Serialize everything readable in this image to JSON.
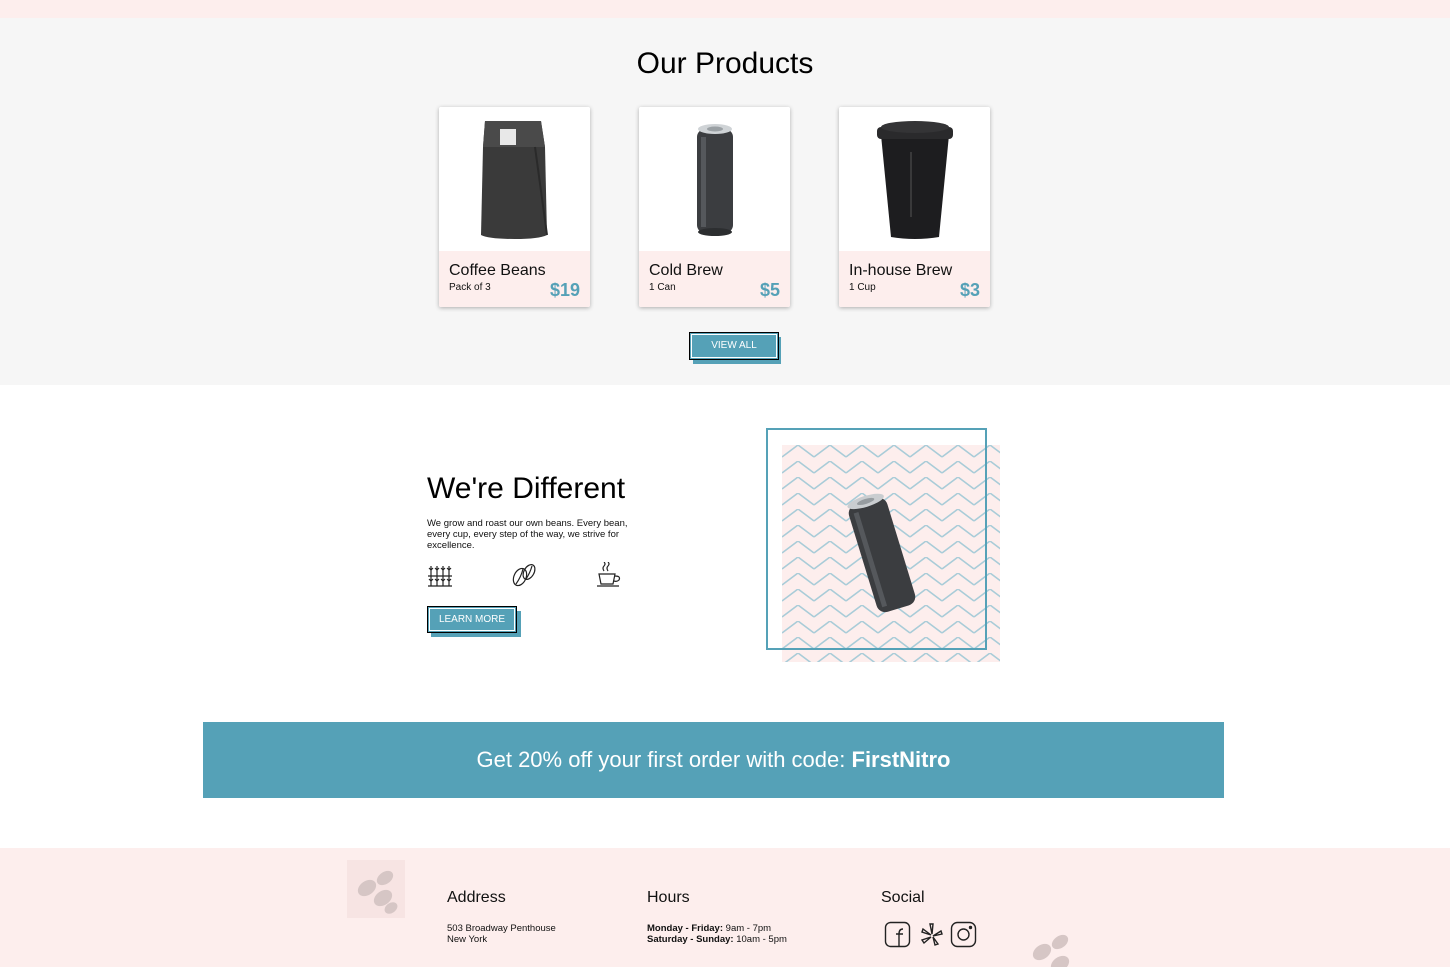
{
  "products_section": {
    "title": "Our Products",
    "items": [
      {
        "name": "Coffee Beans",
        "qty": "Pack of 3",
        "price": "$19"
      },
      {
        "name": "Cold Brew",
        "qty": "1 Can",
        "price": "$5"
      },
      {
        "name": "In-house Brew",
        "qty": "1 Cup",
        "price": "$3"
      }
    ],
    "view_all_label": "VIEW ALL"
  },
  "different_section": {
    "title": "We're Different",
    "text": "We grow and roast our own beans. Every bean, every cup, every step of the way, we strive for excellence.",
    "icons": [
      "plants-icon",
      "coffee-bean-icon",
      "coffee-cup-icon"
    ],
    "learn_more_label": "LEARN MORE"
  },
  "promo": {
    "text": "Get 20% off your first order with code: ",
    "code": "FirstNitro"
  },
  "footer": {
    "address_heading": "Address",
    "address_line1": "503 Broadway Penthouse",
    "address_line2": "New York",
    "hours_heading": "Hours",
    "hours_weekday_label": "Monday - Friday:",
    "hours_weekday_value": " 9am - 7pm",
    "hours_weekend_label": "Saturday - Sunday:",
    "hours_weekend_value": " 10am - 5pm",
    "social_heading": "Social",
    "social_icons": [
      "facebook-icon",
      "yelp-icon",
      "instagram-icon"
    ]
  },
  "colors": {
    "accent": "#55a1b7",
    "pink": "#fdeeed",
    "gray": "#f6f6f6"
  }
}
